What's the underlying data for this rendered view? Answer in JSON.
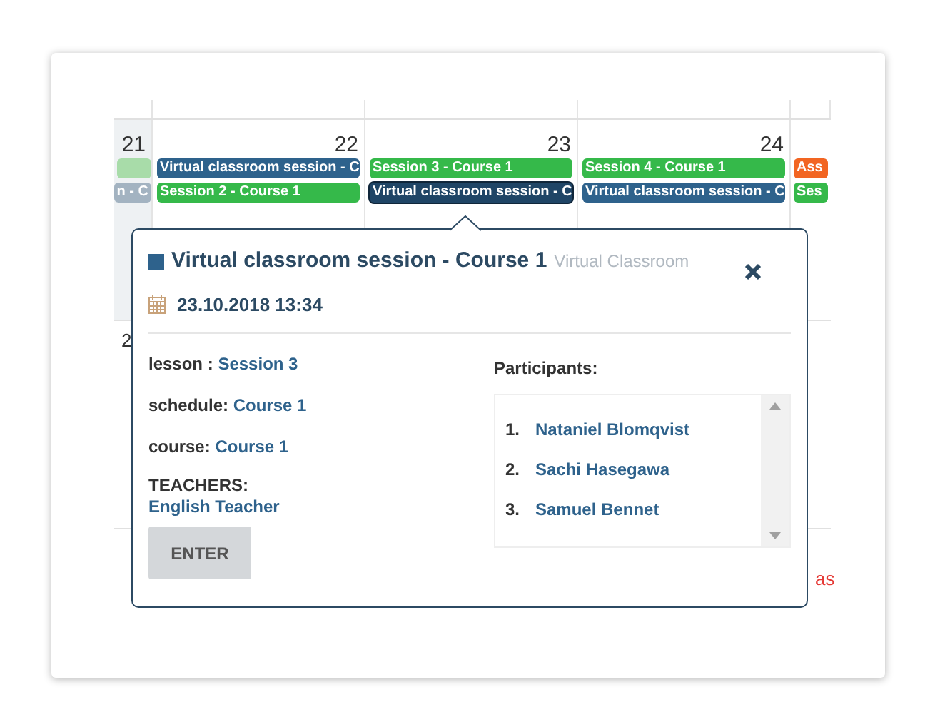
{
  "calendar": {
    "days": [
      {
        "number": "21",
        "events": [
          {
            "color": "#a8dca9",
            "selected": false
          },
          {
            "text": "n - C",
            "color": "#a3b3c1",
            "selected": false
          }
        ]
      },
      {
        "number": "22",
        "events": [
          {
            "text": "Virtual classroom session - C",
            "color": "#2e628c",
            "selected": false
          },
          {
            "text": "Session 2 - Course 1",
            "color": "#35b94a",
            "selected": false
          }
        ]
      },
      {
        "number": "23",
        "events": [
          {
            "text": "Session 3 - Course 1",
            "color": "#35b94a",
            "selected": false
          },
          {
            "text": "Virtual classroom session - C",
            "color": "#1f4566",
            "selected": true
          }
        ]
      },
      {
        "number": "24",
        "events": [
          {
            "text": "Session 4 - Course 1",
            "color": "#35b94a",
            "selected": false
          },
          {
            "text": "Virtual classroom session - C",
            "color": "#2e628c",
            "selected": false
          }
        ]
      },
      {
        "events": [
          {
            "text": "Ass",
            "color": "#f26522",
            "selected": false
          },
          {
            "text": "Ses",
            "color": "#35b94a",
            "selected": false
          }
        ]
      }
    ],
    "second_week": {
      "day_number": "2",
      "event": {
        "text": "as",
        "color": "#e53935"
      }
    }
  },
  "popup": {
    "title": "Virtual classroom session - Course 1",
    "type": "Virtual Classroom",
    "date": "23.10.2018 13:34",
    "fields": [
      {
        "label": "lesson :",
        "value": "Session 3"
      },
      {
        "label": "schedule:",
        "value": "Course 1"
      },
      {
        "label": "course:",
        "value": "Course 1"
      }
    ],
    "teachers": {
      "label": "TEACHERS:",
      "value": "English Teacher"
    },
    "enter_button": "ENTER",
    "participants": {
      "title": "Participants:",
      "items": [
        {
          "number": "1.",
          "name": "Nataniel Blomqvist"
        },
        {
          "number": "2.",
          "name": "Sachi Hasegawa"
        },
        {
          "number": "3.",
          "name": "Samuel Bennet"
        }
      ]
    }
  }
}
